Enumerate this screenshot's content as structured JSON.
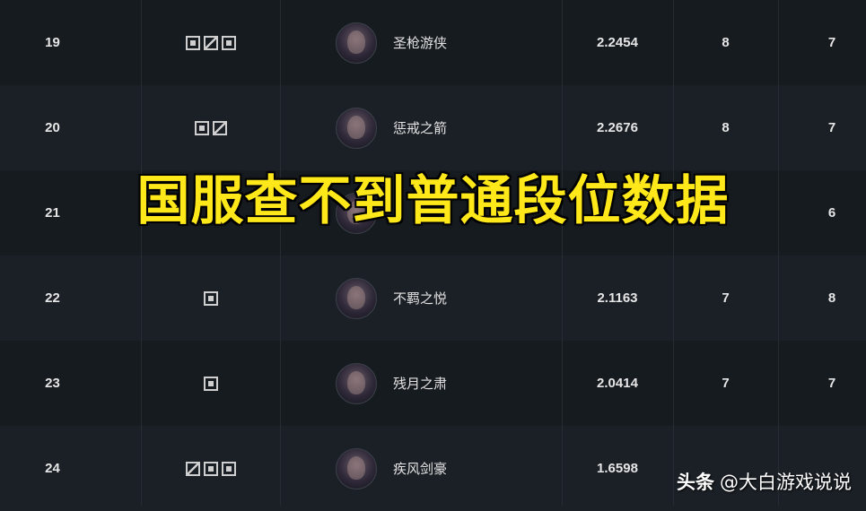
{
  "banner": {
    "text": "国服查不到普通段位数据"
  },
  "watermark": {
    "brand": "头条",
    "account": "@大白游戏说说"
  },
  "rows": [
    {
      "rank": "19",
      "positions": [
        "square",
        "diagonal",
        "square"
      ],
      "hero": "圣枪游侠",
      "score": "2.2454",
      "col1": "8",
      "col2": "7"
    },
    {
      "rank": "20",
      "positions": [
        "square",
        "diagonal"
      ],
      "hero": "惩戒之箭",
      "score": "2.2676",
      "col1": "8",
      "col2": "7"
    },
    {
      "rank": "21",
      "positions": [],
      "hero": "",
      "score": "",
      "col1": "",
      "col2": "6"
    },
    {
      "rank": "22",
      "positions": [
        "square"
      ],
      "hero": "不羁之悦",
      "score": "2.1163",
      "col1": "7",
      "col2": "8"
    },
    {
      "rank": "23",
      "positions": [
        "square"
      ],
      "hero": "残月之肃",
      "score": "2.0414",
      "col1": "7",
      "col2": "7"
    },
    {
      "rank": "24",
      "positions": [
        "diagonal",
        "square",
        "square"
      ],
      "hero": "疾风剑豪",
      "score": "1.6598",
      "col1": "",
      "col2": ""
    }
  ]
}
